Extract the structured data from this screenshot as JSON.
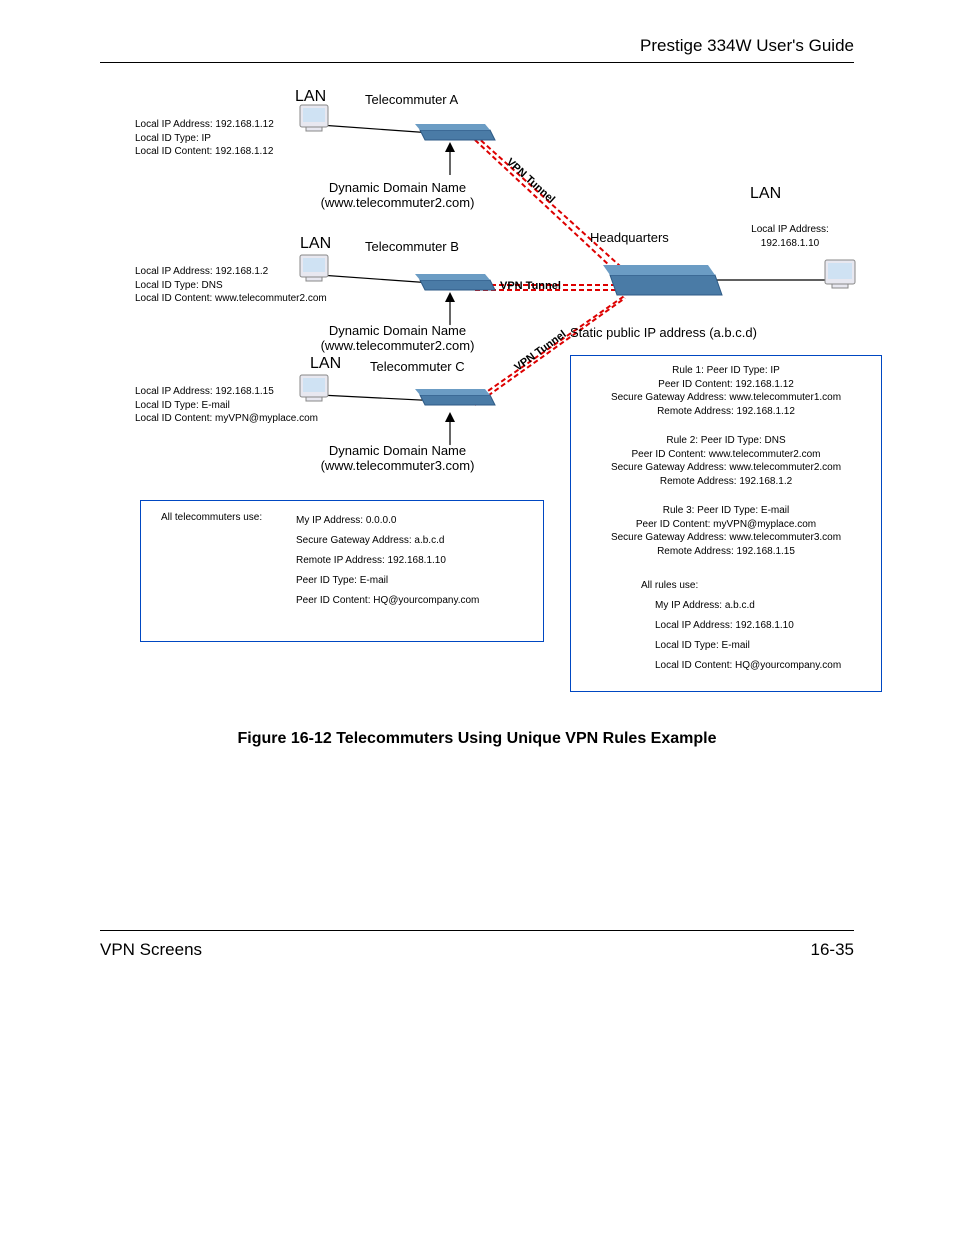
{
  "header": {
    "title": "Prestige 334W User's Guide"
  },
  "footer": {
    "section": "VPN Screens",
    "page": "16-35"
  },
  "caption": "Figure 16-12 Telecommuters Using Unique VPN Rules Example",
  "labels": {
    "lanA": "LAN",
    "lanB": "LAN",
    "lanC": "LAN",
    "lanHQ": "LAN",
    "titleA": "Telecommuter A",
    "titleB": "Telecommuter B",
    "titleC": "Telecommuter C",
    "hq": "Headquarters",
    "ddnA1": "Dynamic Domain Name",
    "ddnA2": "(www.telecommuter2.com)",
    "ddnB1": "Dynamic Domain Name",
    "ddnB2": "(www.telecommuter2.com)",
    "ddnC1": "Dynamic Domain Name",
    "ddnC2": "(www.telecommuter3.com)",
    "vpnTunnel": "VPN Tunnel",
    "vpnTunnelDiag1": "VPN Tunnel",
    "vpnTunnelDiag2": "VPN Tunnel",
    "staticIP": "Static public IP address (a.b.c.d)"
  },
  "nodeA": {
    "l1": "Local IP Address: 192.168.1.12",
    "l2": "Local ID Type: IP",
    "l3": "Local ID Content: 192.168.1.12"
  },
  "nodeB": {
    "l1": "Local IP Address: 192.168.1.2",
    "l2": "Local ID Type: DNS",
    "l3": "Local ID Content: www.telecommuter2.com"
  },
  "nodeC": {
    "l1": "Local IP Address: 192.168.1.15",
    "l2": "Local ID Type: E-mail",
    "l3": "Local ID Content: myVPN@myplace.com"
  },
  "hqSide": {
    "l1": "Local IP Address:",
    "l2": "192.168.1.10"
  },
  "telecommuterBox": {
    "title": "All telecommuters use:",
    "l1": "My IP Address: 0.0.0.0",
    "l2": "Secure Gateway Address: a.b.c.d",
    "l3": "Remote IP Address: 192.168.1.10",
    "l4": "Peer  ID Type: E-mail",
    "l5": "Peer ID Content: HQ@yourcompany.com"
  },
  "hqBox": {
    "r1a": "Rule 1: Peer ID Type: IP",
    "r1b": "Peer ID Content: 192.168.1.12",
    "r1c": "Secure Gateway Address: www.telecommuter1.com",
    "r1d": "Remote Address: 192.168.1.12",
    "r2a": "Rule 2: Peer ID Type: DNS",
    "r2b": "Peer ID Content: www.telecommuter2.com",
    "r2c": "Secure Gateway Address: www.telecommuter2.com",
    "r2d": "Remote Address: 192.168.1.2",
    "r3a": "Rule 3: Peer ID Type: E-mail",
    "r3b": "Peer ID Content: myVPN@myplace.com",
    "r3c": "Secure Gateway Address: www.telecommuter3.com",
    "r3d": "Remote Address: 192.168.1.15",
    "allTitle": "All rules use:",
    "a1": "My IP Address: a.b.c.d",
    "a2": "Local IP Address: 192.168.1.10",
    "a3": "Local ID Type: E-mail",
    "a4": "Local ID Content: HQ@yourcompany.com"
  }
}
